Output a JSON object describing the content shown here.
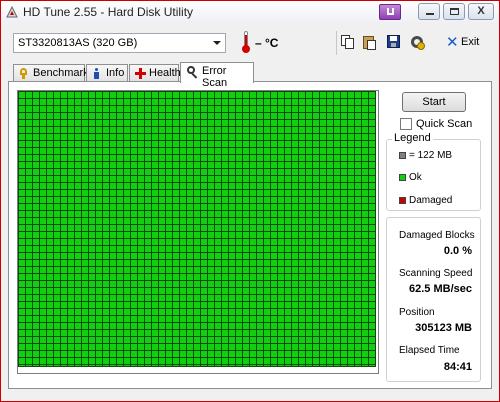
{
  "window": {
    "title": "HD Tune 2.55 - Hard Disk Utility",
    "close_glyph": "X"
  },
  "toolbar": {
    "drive": "ST3320813AS (320 GB)",
    "temperature": "– °C",
    "exit_label": "Exit",
    "icons": [
      "copy-icon",
      "paste-icon",
      "save-icon",
      "options-icon",
      "exit-icon"
    ]
  },
  "tabs": [
    {
      "label": "Benchmark",
      "active": false
    },
    {
      "label": "Info",
      "active": false
    },
    {
      "label": "Health",
      "active": false
    },
    {
      "label": "Error Scan",
      "active": true
    }
  ],
  "scan": {
    "start_label": "Start",
    "quick_scan_label": "Quick Scan",
    "quick_scan_checked": false,
    "legend": {
      "title": "Legend",
      "block_size": "= 122 MB",
      "ok": "Ok",
      "damaged": "Damaged"
    },
    "stats": {
      "damaged_blocks_label": "Damaged Blocks",
      "damaged_blocks_value": "0.0 %",
      "scanning_speed_label": "Scanning Speed",
      "scanning_speed_value": "62.5 MB/sec",
      "position_label": "Position",
      "position_value": "305123 MB",
      "elapsed_label": "Elapsed Time",
      "elapsed_value": "84:41"
    }
  },
  "colors": {
    "ok": "#10d010",
    "damaged": "#cc0000",
    "block": "#808080",
    "grid_line": "#0e4a0e"
  }
}
